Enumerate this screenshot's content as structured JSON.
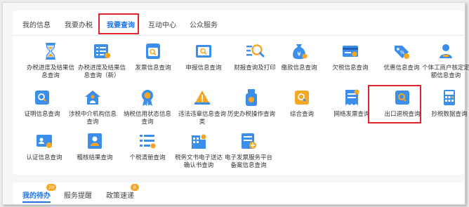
{
  "tabs": [
    {
      "label": "我的信息"
    },
    {
      "label": "我要办税"
    },
    {
      "label": "我要查询"
    },
    {
      "label": "互动中心"
    },
    {
      "label": "公众服务"
    }
  ],
  "active_tab": "我要查询",
  "items": [
    {
      "label": "办税进度及结果信息查询",
      "icon": "hourglass-icon"
    },
    {
      "label": "办税进度及结果信息查询（新）",
      "icon": "document-list-icon"
    },
    {
      "label": "发票信息查询",
      "icon": "invoice-search-icon"
    },
    {
      "label": "申报信息查询",
      "icon": "declaration-search-icon"
    },
    {
      "label": "财报查询及打印",
      "icon": "report-search-icon"
    },
    {
      "label": "缴款信息查询",
      "icon": "money-bag-icon"
    },
    {
      "label": "欠税信息查询",
      "icon": "card-icon"
    },
    {
      "label": "优惠信息查询",
      "icon": "discount-tag-icon"
    },
    {
      "label": "个体工商户核定定额信息查询",
      "icon": "person-icon"
    },
    {
      "label": "证明信息查询",
      "icon": "certificate-search-icon"
    },
    {
      "label": "涉税中介机构信息查询",
      "icon": "agency-house-icon"
    },
    {
      "label": "纳税信用状态信息查询",
      "icon": "credit-medal-icon"
    },
    {
      "label": "违法违章信息查询类",
      "icon": "warning-icon"
    },
    {
      "label": "历史办税操作查询",
      "icon": "history-usb-icon"
    },
    {
      "label": "综合查询",
      "icon": "composite-search-icon"
    },
    {
      "label": "网络发票查询",
      "icon": "online-invoice-icon"
    },
    {
      "label": "出口退税查询",
      "icon": "export-refund-search-icon"
    },
    {
      "label": "抄税数据查询",
      "icon": "calculator-icon"
    },
    {
      "label": "认证信息查询",
      "icon": "id-card-icon"
    },
    {
      "label": "稽核结果查询",
      "icon": "audit-person-icon"
    },
    {
      "label": "个税清册查询",
      "icon": "tax-list-icon"
    },
    {
      "label": "税务文书电子送达确认书查询",
      "icon": "building-icon"
    },
    {
      "label": "电子发票服务平台备案信息查询",
      "icon": "e-invoice-filing-icon"
    }
  ],
  "bottom_tabs": [
    {
      "label": "我的待办",
      "badge": "20"
    },
    {
      "label": "服务提醒",
      "badge": ""
    },
    {
      "label": "政策速递",
      "badge": "8"
    }
  ],
  "colors": {
    "accent": "#1f74e8",
    "highlight": "#e0242c",
    "icon_blue": "#3b8ee9",
    "icon_orange": "#f5a623",
    "badge": "#f5a623"
  }
}
